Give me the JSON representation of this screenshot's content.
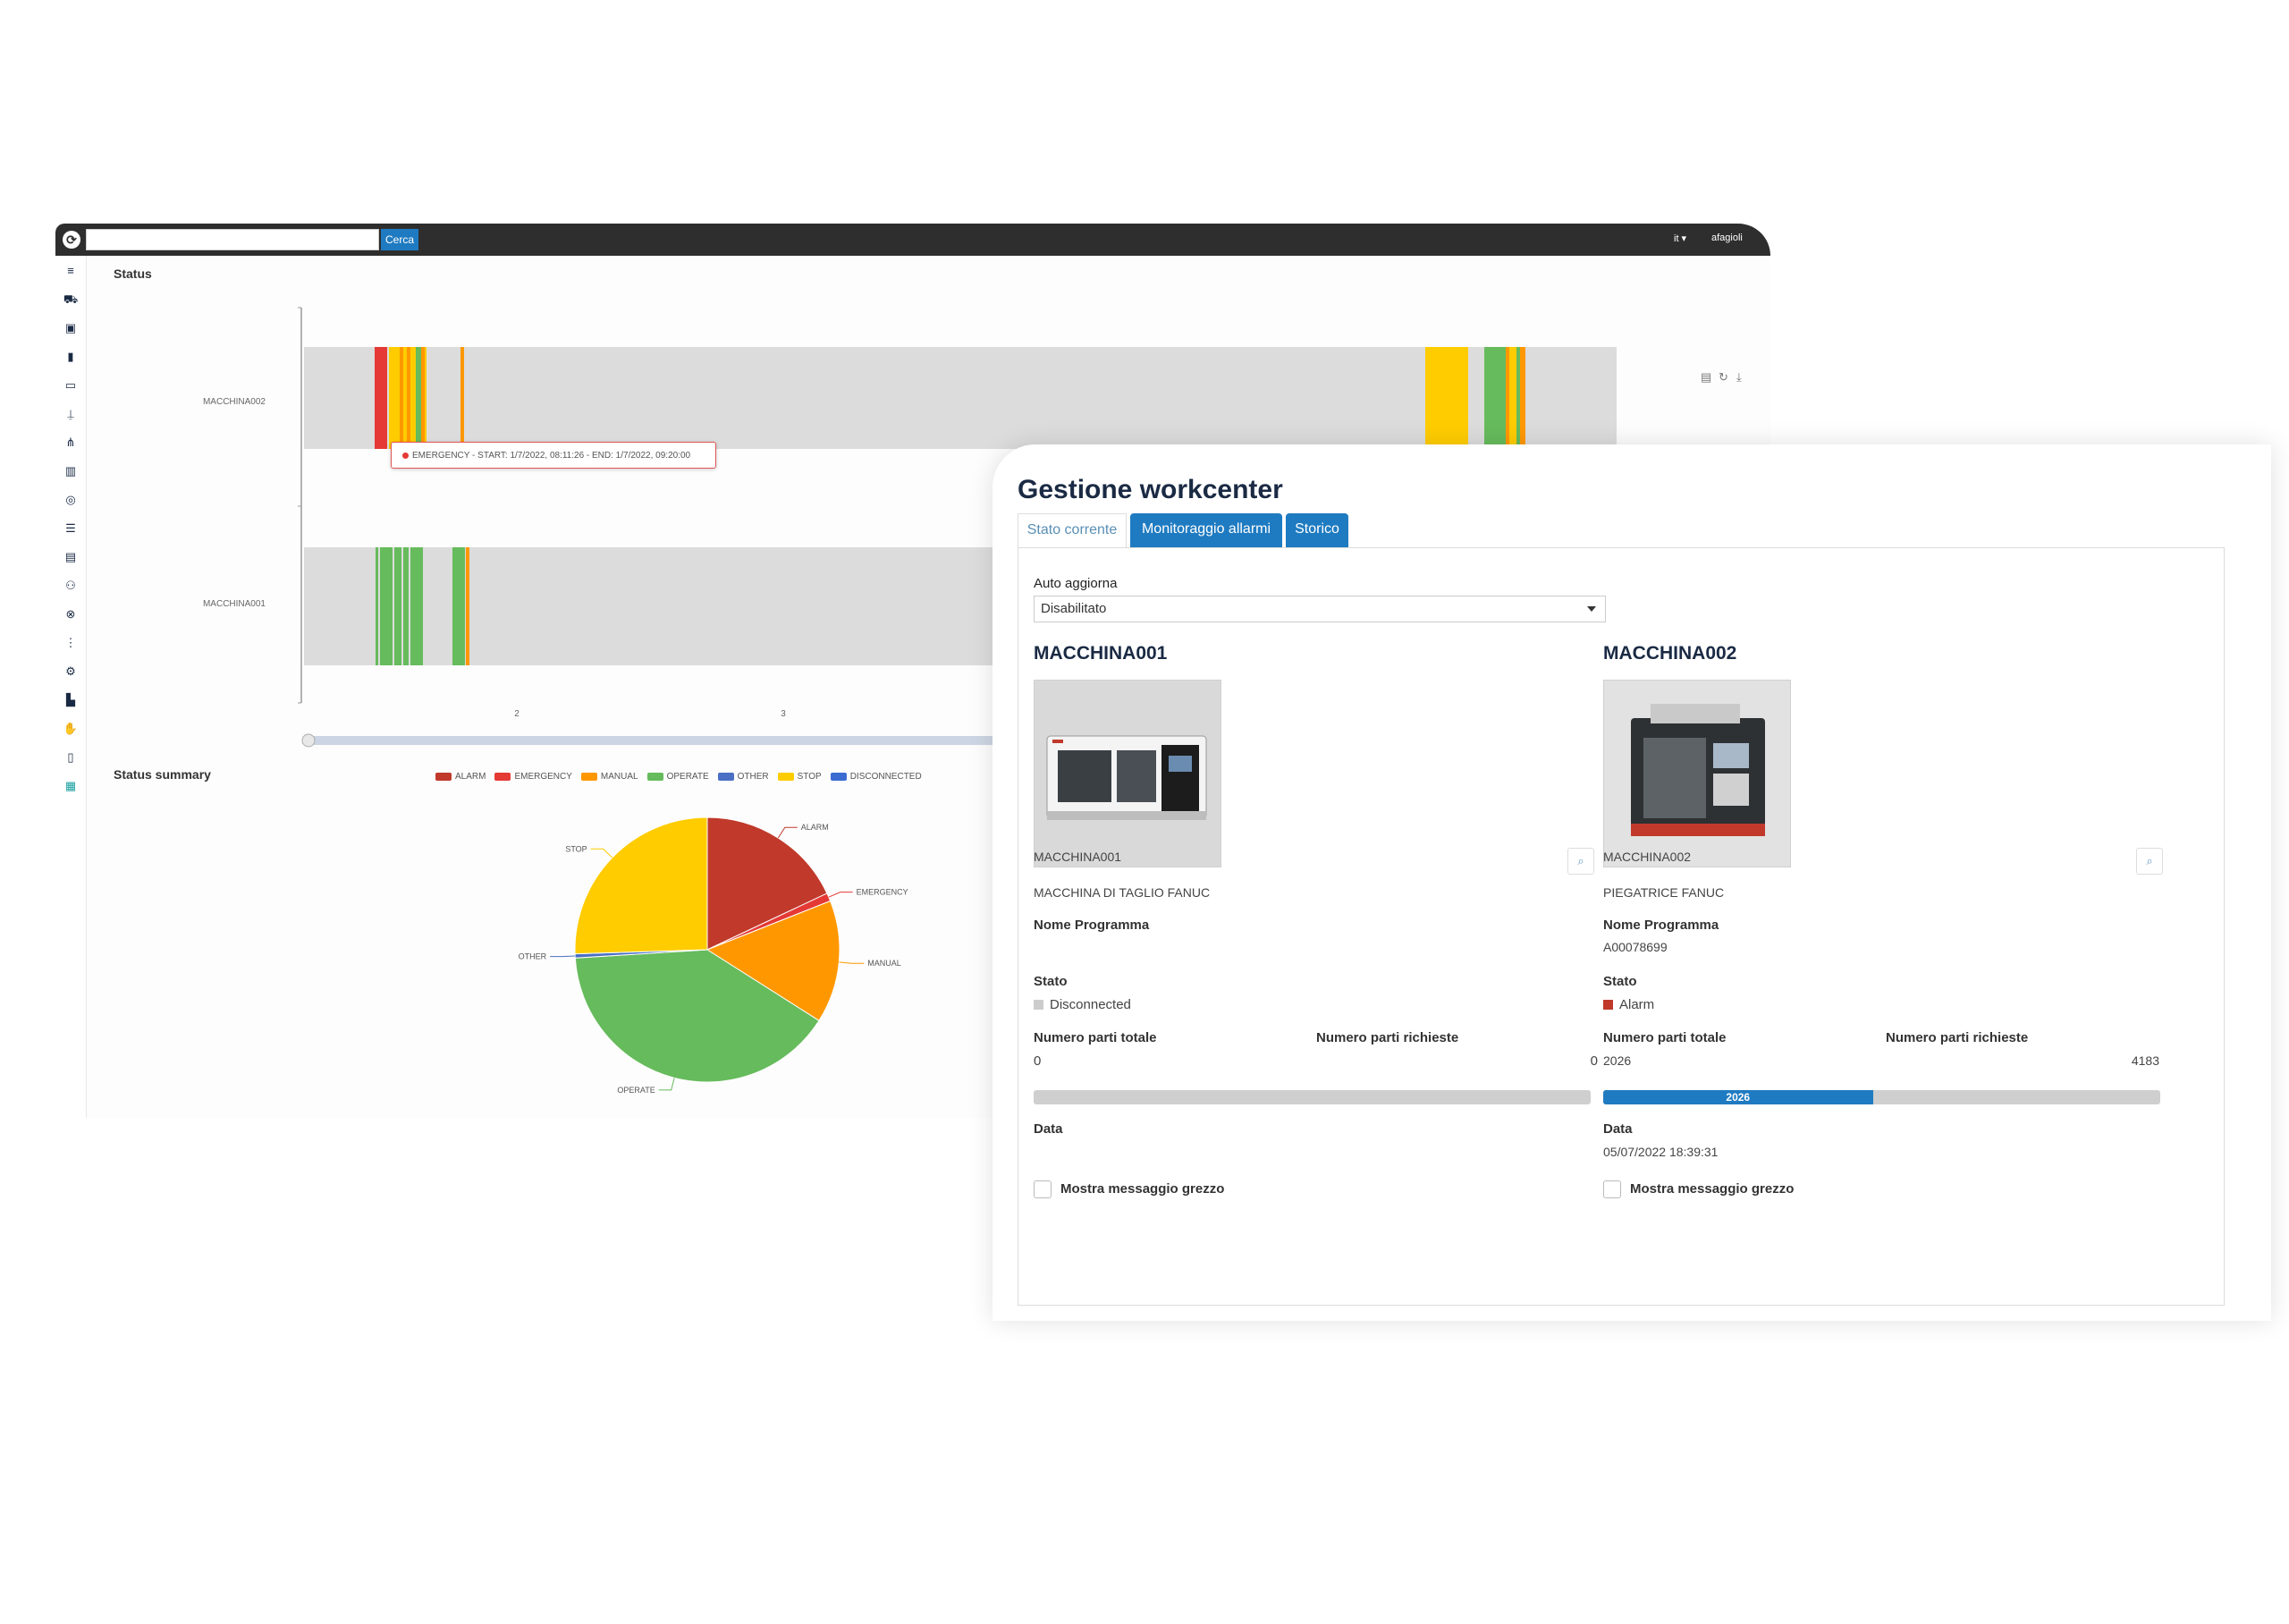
{
  "topbar": {
    "search_placeholder": "",
    "search_button": "Cerca",
    "language": "it ▾",
    "username": "afagioli"
  },
  "sidebar": {
    "icons": [
      "menu-icon",
      "cart-icon",
      "box-icon",
      "tool-icon",
      "folder-icon",
      "robot-arm-icon",
      "hierarchy-icon",
      "book-icon",
      "headset-icon",
      "list-icon",
      "calendar-icon",
      "users-icon",
      "link-icon",
      "filter-list-icon",
      "gears-icon",
      "factory-icon",
      "hand-icon",
      "document-icon",
      "sheet-icon"
    ]
  },
  "status_section": {
    "title": "Status",
    "rows": [
      "MACCHINA002",
      "MACCHINA001"
    ],
    "x_ticks": [
      "2",
      "3"
    ],
    "tooltip": "EMERGENCY - START: 1/7/2022, 08:11:26 - END: 1/7/2022, 09:20:00"
  },
  "summary_section": {
    "title": "Status summary"
  },
  "colors": {
    "ALARM": "#c0392b",
    "EMERGENCY": "#e53935",
    "MANUAL": "#ff9800",
    "OPERATE": "#66bb5c",
    "OTHER": "#4a6fc4",
    "STOP": "#ffcc00",
    "DISCONNECTED": "#3a6bd1",
    "accent": "#1f7bc1",
    "title": "#1a2a44"
  },
  "chart_data": [
    {
      "type": "bar",
      "subtype": "timeline",
      "title": "Status",
      "categories": [
        "MACCHINA002",
        "MACCHINA001"
      ],
      "x_ticks": [
        "2",
        "3"
      ],
      "grid": false
    },
    {
      "type": "pie",
      "title": "Status summary",
      "legend_position": "top",
      "legend": [
        "ALARM",
        "EMERGENCY",
        "MANUAL",
        "OPERATE",
        "OTHER",
        "STOP",
        "DISCONNECTED"
      ],
      "labels": [
        "ALARM",
        "EMERGENCY",
        "MANUAL",
        "OPERATE",
        "OTHER",
        "STOP"
      ],
      "values": [
        18,
        1,
        15,
        40,
        0.5,
        25.5
      ]
    }
  ],
  "workcenter": {
    "title": "Gestione workcenter",
    "tabs": [
      "Stato corrente",
      "Monitoraggio allarmi",
      "Storico"
    ],
    "auto_update_label": "Auto aggiorna",
    "auto_update_value": "Disabilitato",
    "machines": [
      {
        "title": "MACCHINA001",
        "code": "MACCHINA001",
        "description": "MACCHINA DI TAGLIO FANUC",
        "program_label": "Nome Programma",
        "program_value": "",
        "state_label": "Stato",
        "state_value": "Disconnected",
        "state_color": "#cccccc",
        "total_parts_label": "Numero parti totale",
        "total_parts": "0",
        "requested_parts_label": "Numero parti richieste",
        "requested_parts": "0",
        "progress_fraction": 0,
        "progress_text": "",
        "date_label": "Data",
        "date_value": "",
        "raw_msg_label": "Mostra messaggio grezzo"
      },
      {
        "title": "MACCHINA002",
        "code": "MACCHINA002",
        "description": "PIEGATRICE FANUC",
        "program_label": "Nome Programma",
        "program_value": "A00078699",
        "state_label": "Stato",
        "state_value": "Alarm",
        "state_color": "#c0392b",
        "total_parts_label": "Numero parti totale",
        "total_parts": "2026",
        "requested_parts_label": "Numero parti richieste",
        "requested_parts": "4183",
        "progress_fraction": 0.484,
        "progress_text": "2026",
        "date_label": "Data",
        "date_value": "05/07/2022 18:39:31",
        "raw_msg_label": "Mostra messaggio grezzo"
      }
    ]
  }
}
